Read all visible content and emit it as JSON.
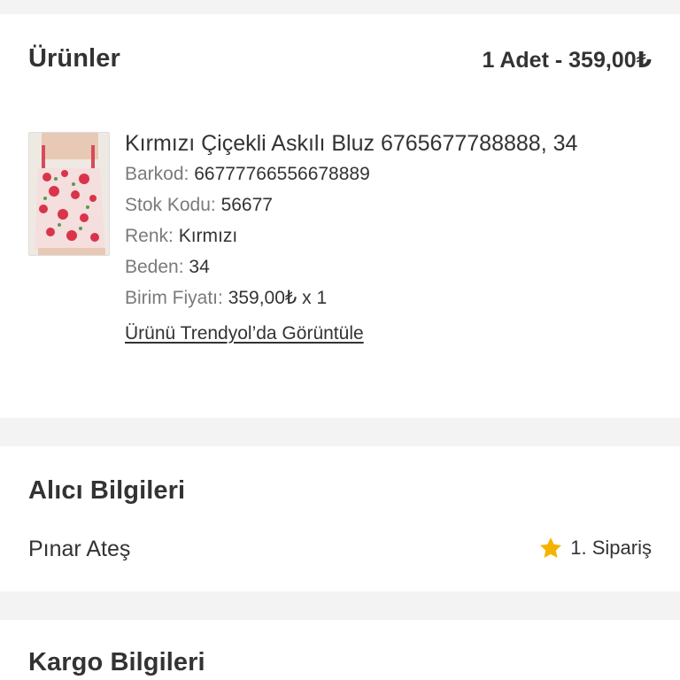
{
  "products": {
    "title": "Ürünler",
    "summary": "1 Adet - 359,00₺",
    "item": {
      "name": "Kırmızı Çiçekli Askılı Bluz 6765677788888, 34",
      "barcode_label": "Barkod:",
      "barcode_value": "66777766556678889",
      "stock_label": "Stok Kodu:",
      "stock_value": "56677",
      "color_label": "Renk:",
      "color_value": "Kırmızı",
      "size_label": "Beden:",
      "size_value": "34",
      "price_label": "Birim Fiyatı:",
      "price_value": "359,00₺ x 1",
      "link": "Ürünü Trendyol’da Görüntüle"
    }
  },
  "buyer": {
    "title": "Alıcı Bilgileri",
    "name": "Pınar Ateş",
    "order_count": "1. Sipariş",
    "badge_icon": "star-icon",
    "star_color": "#f5b301"
  },
  "cargo": {
    "title": "Kargo Bilgileri"
  },
  "colors": {
    "background": "#f3f3f3",
    "card": "#ffffff",
    "text": "#333333",
    "muted": "#7a7a7a"
  }
}
